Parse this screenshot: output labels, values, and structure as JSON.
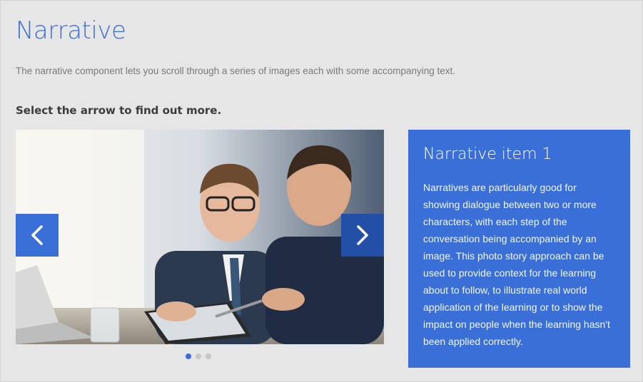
{
  "page": {
    "title": "Narrative",
    "body": "The narrative component lets you scroll through a series of images each with some accompanying text.",
    "instruction": "Select the arrow to find out more."
  },
  "slider": {
    "image_alt": "Two businessmen in suits smiling and looking at a tablet",
    "prev_icon": "chevron-left-icon",
    "next_icon": "chevron-right-icon",
    "dots": [
      {
        "active": true
      },
      {
        "active": false
      },
      {
        "active": false
      }
    ]
  },
  "item": {
    "title": "Narrative item 1",
    "body": "Narratives are particularly good for showing dialogue between two or more characters, with each step of the conversation being accompanied by an image. This photo story approach can be used to provide context for the learning about to follow, to illustrate real world application of the learning or to show the impact on people when the learning hasn't been applied correctly."
  },
  "colors": {
    "accent": "#3b6fd8",
    "accent_dark": "#234fa6",
    "background": "#e6e6e6",
    "text_muted": "#7a7a7a",
    "text_dark": "#3c3c3c"
  }
}
